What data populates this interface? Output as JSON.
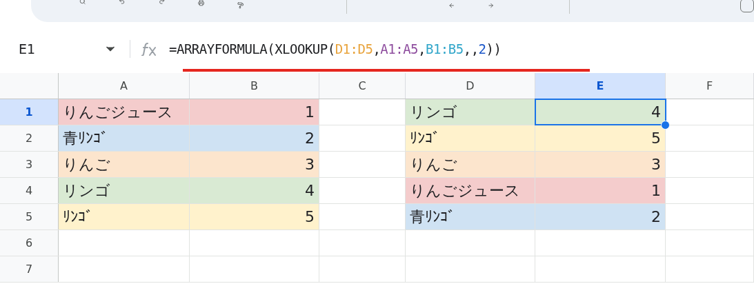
{
  "name_box": {
    "value": "E1"
  },
  "formula": [
    {
      "text": "=ARRAYFORMULA(XLOOKUP(",
      "color": "#202124"
    },
    {
      "text": "D1:D5",
      "color": "#e8a33c"
    },
    {
      "text": ",",
      "color": "#202124"
    },
    {
      "text": "A1:A5",
      "color": "#8e4d9e"
    },
    {
      "text": ",",
      "color": "#202124"
    },
    {
      "text": "B1:B5",
      "color": "#2fa5c9"
    },
    {
      "text": ",,",
      "color": "#202124"
    },
    {
      "text": "2",
      "color": "#1a56c9"
    },
    {
      "text": "))",
      "color": "#202124"
    }
  ],
  "columns": [
    {
      "label": "A",
      "selected": false
    },
    {
      "label": "B",
      "selected": false
    },
    {
      "label": "C",
      "selected": false
    },
    {
      "label": "D",
      "selected": false
    },
    {
      "label": "E",
      "selected": true
    },
    {
      "label": "F",
      "selected": false
    }
  ],
  "rows": [
    {
      "label": "1",
      "selected": true,
      "cells": [
        {
          "text": "りんごジュース",
          "kind": "text",
          "color": "#f4cccc"
        },
        {
          "text": "1",
          "kind": "number",
          "color": "#f4cccc"
        },
        {},
        {
          "text": "リンゴ",
          "kind": "text",
          "color": "#d9ead3"
        },
        {
          "text": "4",
          "kind": "number",
          "color": "#d9ead3",
          "selected": true
        },
        {}
      ]
    },
    {
      "label": "2",
      "selected": false,
      "cells": [
        {
          "text": "青ﾘﾝｺﾞ",
          "kind": "text",
          "color": "#cfe2f3"
        },
        {
          "text": "2",
          "kind": "number",
          "color": "#cfe2f3"
        },
        {},
        {
          "text": "ﾘﾝｺﾞ",
          "kind": "text",
          "color": "#fff2cc"
        },
        {
          "text": "5",
          "kind": "number",
          "color": "#fff2cc",
          "selected": false
        },
        {}
      ]
    },
    {
      "label": "3",
      "selected": false,
      "cells": [
        {
          "text": "りんご",
          "kind": "text",
          "color": "#fce5cd"
        },
        {
          "text": "3",
          "kind": "number",
          "color": "#fce5cd"
        },
        {},
        {
          "text": "りんご",
          "kind": "text",
          "color": "#fce5cd"
        },
        {
          "text": "3",
          "kind": "number",
          "color": "#fce5cd",
          "selected": false
        },
        {}
      ]
    },
    {
      "label": "4",
      "selected": false,
      "cells": [
        {
          "text": "リンゴ",
          "kind": "text",
          "color": "#d9ead3"
        },
        {
          "text": "4",
          "kind": "number",
          "color": "#d9ead3"
        },
        {},
        {
          "text": "りんごジュース",
          "kind": "text",
          "color": "#f4cccc"
        },
        {
          "text": "1",
          "kind": "number",
          "color": "#f4cccc",
          "selected": false
        },
        {}
      ]
    },
    {
      "label": "5",
      "selected": false,
      "cells": [
        {
          "text": "ﾘﾝｺﾞ",
          "kind": "text",
          "color": "#fff2cc"
        },
        {
          "text": "5",
          "kind": "number",
          "color": "#fff2cc"
        },
        {},
        {
          "text": "青ﾘﾝｺﾞ",
          "kind": "text",
          "color": "#cfe2f3"
        },
        {
          "text": "2",
          "kind": "number",
          "color": "#cfe2f3",
          "selected": false
        },
        {}
      ]
    },
    {
      "label": "6",
      "selected": false,
      "cells": [
        {},
        {},
        {},
        {},
        {},
        {}
      ]
    },
    {
      "label": "7",
      "selected": false,
      "cells": [
        {},
        {},
        {},
        {},
        {},
        {}
      ]
    }
  ]
}
